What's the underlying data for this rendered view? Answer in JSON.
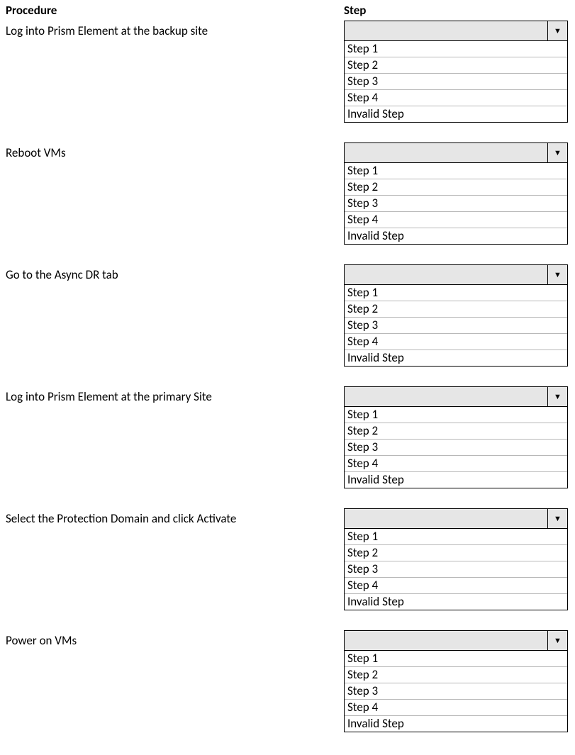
{
  "headers": {
    "procedure": "Procedure",
    "step": "Step"
  },
  "options": [
    "Step 1",
    "Step 2",
    "Step 3",
    "Step 4",
    "Invalid Step"
  ],
  "items": [
    {
      "label": "Log into Prism Element at the backup site"
    },
    {
      "label": "Reboot VMs"
    },
    {
      "label": "Go to the Async DR tab"
    },
    {
      "label": "Log into Prism Element at the primary Site"
    },
    {
      "label": "Select the Protection Domain and click Activate"
    },
    {
      "label": "Power on VMs"
    }
  ]
}
